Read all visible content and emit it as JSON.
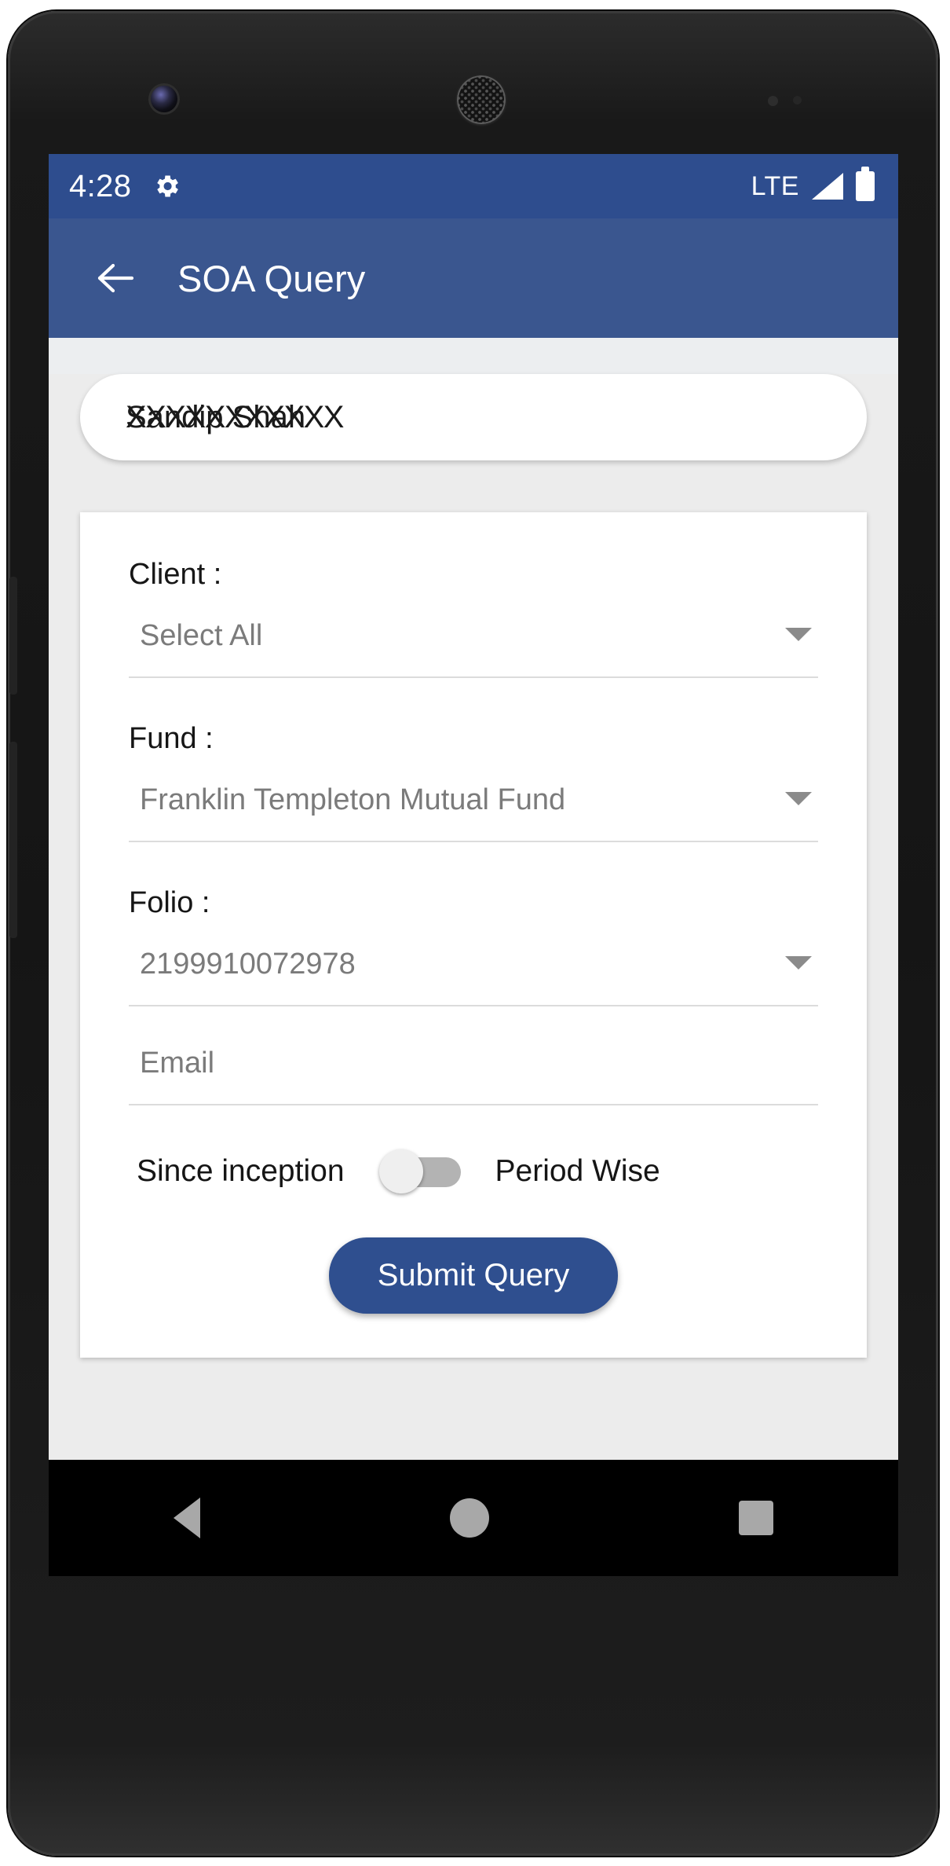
{
  "status_bar": {
    "time": "4:28",
    "settings_icon": "gear-icon",
    "network_label": "LTE",
    "signal_icon": "signal-bars-icon",
    "battery_icon": "battery-icon"
  },
  "app_bar": {
    "back_icon": "back-arrow-icon",
    "title": "SOA Query"
  },
  "account": {
    "name": "Sandip Shah",
    "redaction_overlay": "XXXXXXXXXXX"
  },
  "form": {
    "client": {
      "label": "Client :",
      "value": "Select All",
      "caret_icon": "chevron-down-icon"
    },
    "fund": {
      "label": "Fund :",
      "value": "Franklin Templeton Mutual Fund",
      "caret_icon": "chevron-down-icon"
    },
    "folio": {
      "label": "Folio :",
      "value": "2199910072978",
      "caret_icon": "chevron-down-icon"
    },
    "email": {
      "placeholder": "Email",
      "value": ""
    },
    "period_toggle": {
      "left_label": "Since inception",
      "right_label": "Period Wise",
      "state": "off"
    },
    "submit_label": "Submit Query"
  },
  "navigation_bar": {
    "back": "nav-back-icon",
    "home": "nav-home-icon",
    "recents": "nav-recents-icon"
  },
  "colors": {
    "status_bar": "#2e4d8e",
    "app_bar": "#3a568f",
    "accent": "#2f4f8f",
    "page_background": "#ececec"
  }
}
